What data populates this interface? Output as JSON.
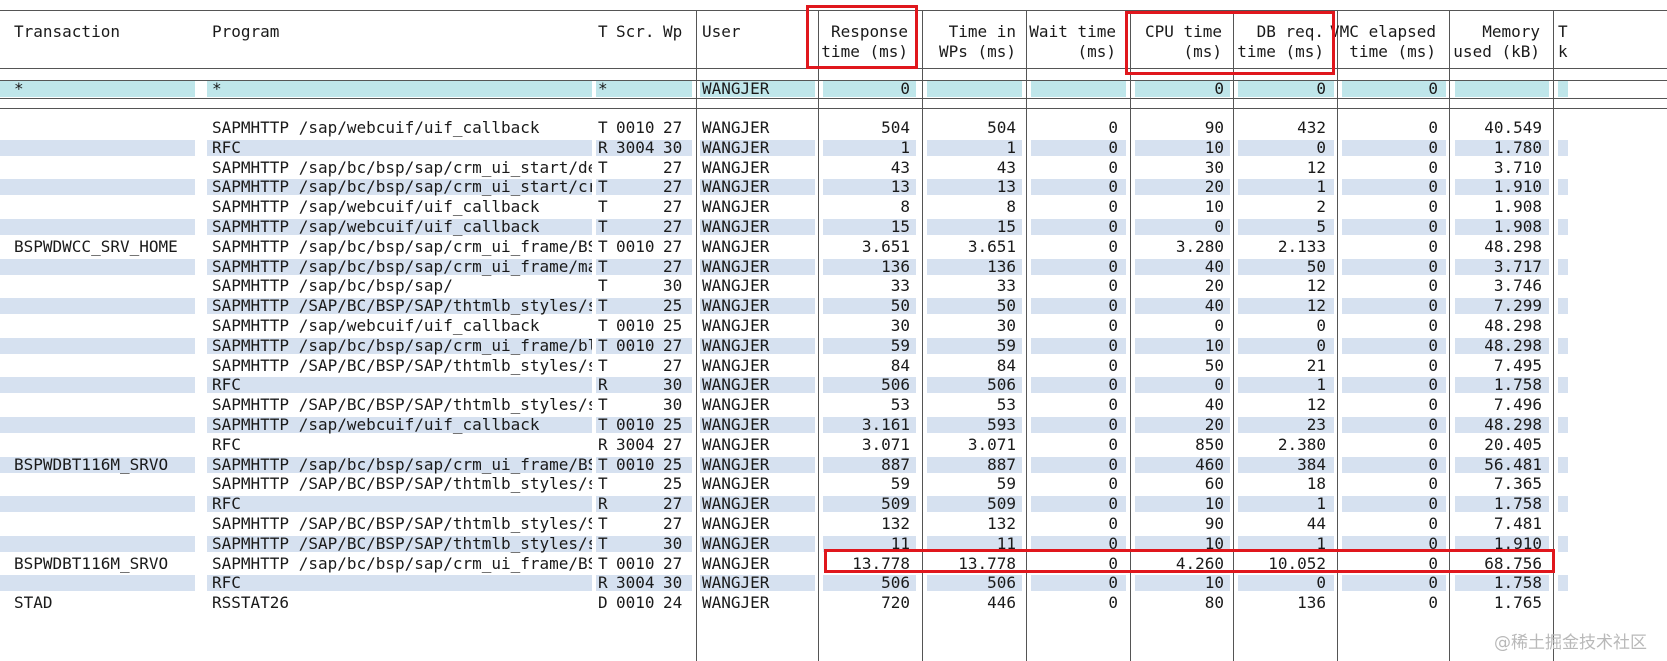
{
  "columns": [
    {
      "key": "transaction",
      "label": "Transaction",
      "align": "left"
    },
    {
      "key": "program",
      "label": "Program",
      "align": "left"
    },
    {
      "key": "type",
      "label": "T",
      "align": "left"
    },
    {
      "key": "screen",
      "label": "Scr.",
      "align": "left"
    },
    {
      "key": "wp",
      "label": "Wp",
      "align": "left"
    },
    {
      "key": "user",
      "label": "User",
      "align": "left"
    },
    {
      "key": "response",
      "label": "Response\ntime (ms)",
      "align": "right"
    },
    {
      "key": "time_wps",
      "label": "Time in\nWPs (ms)",
      "align": "right"
    },
    {
      "key": "wait",
      "label": "Wait time\n(ms)",
      "align": "right"
    },
    {
      "key": "cpu",
      "label": "CPU time\n(ms)",
      "align": "right"
    },
    {
      "key": "db",
      "label": "DB req.\ntime (ms)",
      "align": "right"
    },
    {
      "key": "vmc",
      "label": "VMC elapsed\ntime (ms)",
      "align": "right"
    },
    {
      "key": "mem",
      "label": "Memory\nused (kB)",
      "align": "right"
    },
    {
      "key": "trunc",
      "label": "T\nk",
      "align": "left"
    }
  ],
  "filter_row": {
    "transaction": "*",
    "program": "*",
    "type": "*",
    "screen": "",
    "wp": "",
    "user": "WANGJER",
    "response": "0",
    "time_wps": "",
    "wait": "",
    "cpu": "0",
    "db": "0",
    "vmc": "0",
    "mem": "",
    "trunc": ""
  },
  "rows": [
    {
      "transaction": "",
      "program": "SAPMHTTP /sap/webcuif/uif_callback",
      "type": "T",
      "screen": "0010",
      "wp": "27",
      "user": "WANGJER",
      "response": "504",
      "time_wps": "504",
      "wait": "0",
      "cpu": "90",
      "db": "432",
      "vmc": "0",
      "mem": "40.549"
    },
    {
      "transaction": "",
      "program": "RFC",
      "type": "R",
      "screen": "3004",
      "wp": "30",
      "user": "WANGJER",
      "response": "1",
      "time_wps": "1",
      "wait": "0",
      "cpu": "10",
      "db": "0",
      "vmc": "0",
      "mem": "1.780"
    },
    {
      "transaction": "",
      "program": "SAPMHTTP /sap/bc/bsp/sap/crm_ui_start/de",
      "type": "T",
      "screen": "",
      "wp": "27",
      "user": "WANGJER",
      "response": "43",
      "time_wps": "43",
      "wait": "0",
      "cpu": "30",
      "db": "12",
      "vmc": "0",
      "mem": "3.710"
    },
    {
      "transaction": "",
      "program": "SAPMHTTP /sap/bc/bsp/sap/crm_ui_start/cr",
      "type": "T",
      "screen": "",
      "wp": "27",
      "user": "WANGJER",
      "response": "13",
      "time_wps": "13",
      "wait": "0",
      "cpu": "20",
      "db": "1",
      "vmc": "0",
      "mem": "1.910"
    },
    {
      "transaction": "",
      "program": "SAPMHTTP /sap/webcuif/uif_callback",
      "type": "T",
      "screen": "",
      "wp": "27",
      "user": "WANGJER",
      "response": "8",
      "time_wps": "8",
      "wait": "0",
      "cpu": "10",
      "db": "2",
      "vmc": "0",
      "mem": "1.908"
    },
    {
      "transaction": "",
      "program": "SAPMHTTP /sap/webcuif/uif_callback",
      "type": "T",
      "screen": "",
      "wp": "27",
      "user": "WANGJER",
      "response": "15",
      "time_wps": "15",
      "wait": "0",
      "cpu": "0",
      "db": "5",
      "vmc": "0",
      "mem": "1.908"
    },
    {
      "transaction": "BSPWDWCC_SRV_HOME",
      "program": "SAPMHTTP /sap/bc/bsp/sap/crm_ui_frame/BS",
      "type": "T",
      "screen": "0010",
      "wp": "27",
      "user": "WANGJER",
      "response": "3.651",
      "time_wps": "3.651",
      "wait": "0",
      "cpu": "3.280",
      "db": "2.133",
      "vmc": "0",
      "mem": "48.298"
    },
    {
      "transaction": "",
      "program": "SAPMHTTP /sap/bc/bsp/sap/crm_ui_frame/ma",
      "type": "T",
      "screen": "",
      "wp": "27",
      "user": "WANGJER",
      "response": "136",
      "time_wps": "136",
      "wait": "0",
      "cpu": "40",
      "db": "50",
      "vmc": "0",
      "mem": "3.717"
    },
    {
      "transaction": "",
      "program": "SAPMHTTP /sap/bc/bsp/sap/",
      "type": "T",
      "screen": "",
      "wp": "30",
      "user": "WANGJER",
      "response": "33",
      "time_wps": "33",
      "wait": "0",
      "cpu": "20",
      "db": "12",
      "vmc": "0",
      "mem": "3.746"
    },
    {
      "transaction": "",
      "program": "SAPMHTTP /SAP/BC/BSP/SAP/thtmlb_styles/s",
      "type": "T",
      "screen": "",
      "wp": "25",
      "user": "WANGJER",
      "response": "50",
      "time_wps": "50",
      "wait": "0",
      "cpu": "40",
      "db": "12",
      "vmc": "0",
      "mem": "7.299"
    },
    {
      "transaction": "",
      "program": "SAPMHTTP /sap/webcuif/uif_callback",
      "type": "T",
      "screen": "0010",
      "wp": "25",
      "user": "WANGJER",
      "response": "30",
      "time_wps": "30",
      "wait": "0",
      "cpu": "0",
      "db": "0",
      "vmc": "0",
      "mem": "48.298"
    },
    {
      "transaction": "",
      "program": "SAPMHTTP /sap/bc/bsp/sap/crm_ui_frame/bl",
      "type": "T",
      "screen": "0010",
      "wp": "27",
      "user": "WANGJER",
      "response": "59",
      "time_wps": "59",
      "wait": "0",
      "cpu": "10",
      "db": "0",
      "vmc": "0",
      "mem": "48.298"
    },
    {
      "transaction": "",
      "program": "SAPMHTTP /SAP/BC/BSP/SAP/thtmlb_styles/s",
      "type": "T",
      "screen": "",
      "wp": "27",
      "user": "WANGJER",
      "response": "84",
      "time_wps": "84",
      "wait": "0",
      "cpu": "50",
      "db": "21",
      "vmc": "0",
      "mem": "7.495"
    },
    {
      "transaction": "",
      "program": "RFC",
      "type": "R",
      "screen": "",
      "wp": "30",
      "user": "WANGJER",
      "response": "506",
      "time_wps": "506",
      "wait": "0",
      "cpu": "0",
      "db": "1",
      "vmc": "0",
      "mem": "1.758"
    },
    {
      "transaction": "",
      "program": "SAPMHTTP /SAP/BC/BSP/SAP/thtmlb_styles/s",
      "type": "T",
      "screen": "",
      "wp": "30",
      "user": "WANGJER",
      "response": "53",
      "time_wps": "53",
      "wait": "0",
      "cpu": "40",
      "db": "12",
      "vmc": "0",
      "mem": "7.496"
    },
    {
      "transaction": "",
      "program": "SAPMHTTP /sap/webcuif/uif_callback",
      "type": "T",
      "screen": "0010",
      "wp": "25",
      "user": "WANGJER",
      "response": "3.161",
      "time_wps": "593",
      "wait": "0",
      "cpu": "20",
      "db": "23",
      "vmc": "0",
      "mem": "48.298"
    },
    {
      "transaction": "",
      "program": "RFC",
      "type": "R",
      "screen": "3004",
      "wp": "27",
      "user": "WANGJER",
      "response": "3.071",
      "time_wps": "3.071",
      "wait": "0",
      "cpu": "850",
      "db": "2.380",
      "vmc": "0",
      "mem": "20.405"
    },
    {
      "transaction": "BSPWDBT116M_SRVO",
      "program": "SAPMHTTP /sap/bc/bsp/sap/crm_ui_frame/BS",
      "type": "T",
      "screen": "0010",
      "wp": "25",
      "user": "WANGJER",
      "response": "887",
      "time_wps": "887",
      "wait": "0",
      "cpu": "460",
      "db": "384",
      "vmc": "0",
      "mem": "56.481"
    },
    {
      "transaction": "",
      "program": "SAPMHTTP /SAP/BC/BSP/SAP/thtmlb_styles/s",
      "type": "T",
      "screen": "",
      "wp": "25",
      "user": "WANGJER",
      "response": "59",
      "time_wps": "59",
      "wait": "0",
      "cpu": "60",
      "db": "18",
      "vmc": "0",
      "mem": "7.365"
    },
    {
      "transaction": "",
      "program": "RFC",
      "type": "R",
      "screen": "",
      "wp": "27",
      "user": "WANGJER",
      "response": "509",
      "time_wps": "509",
      "wait": "0",
      "cpu": "10",
      "db": "1",
      "vmc": "0",
      "mem": "1.758"
    },
    {
      "transaction": "",
      "program": "SAPMHTTP /SAP/BC/BSP/SAP/thtmlb_styles/S",
      "type": "T",
      "screen": "",
      "wp": "27",
      "user": "WANGJER",
      "response": "132",
      "time_wps": "132",
      "wait": "0",
      "cpu": "90",
      "db": "44",
      "vmc": "0",
      "mem": "7.481"
    },
    {
      "transaction": "",
      "program": "SAPMHTTP /SAP/BC/BSP/SAP/thtmlb_styles/s",
      "type": "T",
      "screen": "",
      "wp": "30",
      "user": "WANGJER",
      "response": "11",
      "time_wps": "11",
      "wait": "0",
      "cpu": "10",
      "db": "1",
      "vmc": "0",
      "mem": "1.910"
    },
    {
      "transaction": "BSPWDBT116M_SRVO",
      "program": "SAPMHTTP /sap/bc/bsp/sap/crm_ui_frame/BS",
      "type": "T",
      "screen": "0010",
      "wp": "27",
      "user": "WANGJER",
      "response": "13.778",
      "time_wps": "13.778",
      "wait": "0",
      "cpu": "4.260",
      "db": "10.052",
      "vmc": "0",
      "mem": "68.756"
    },
    {
      "transaction": "",
      "program": "RFC",
      "type": "R",
      "screen": "3004",
      "wp": "30",
      "user": "WANGJER",
      "response": "506",
      "time_wps": "506",
      "wait": "0",
      "cpu": "10",
      "db": "0",
      "vmc": "0",
      "mem": "1.758"
    },
    {
      "transaction": "STAD",
      "program": "RSSTAT26",
      "type": "D",
      "screen": "0010",
      "wp": "24",
      "user": "WANGJER",
      "response": "720",
      "time_wps": "446",
      "wait": "0",
      "cpu": "80",
      "db": "136",
      "vmc": "0",
      "mem": "1.765"
    }
  ],
  "highlight_colors": {
    "band": "#d6e1f0",
    "filter": "#bfe6ea",
    "marker": "#e0171d"
  },
  "watermark": "@稀土掘金技术社区"
}
